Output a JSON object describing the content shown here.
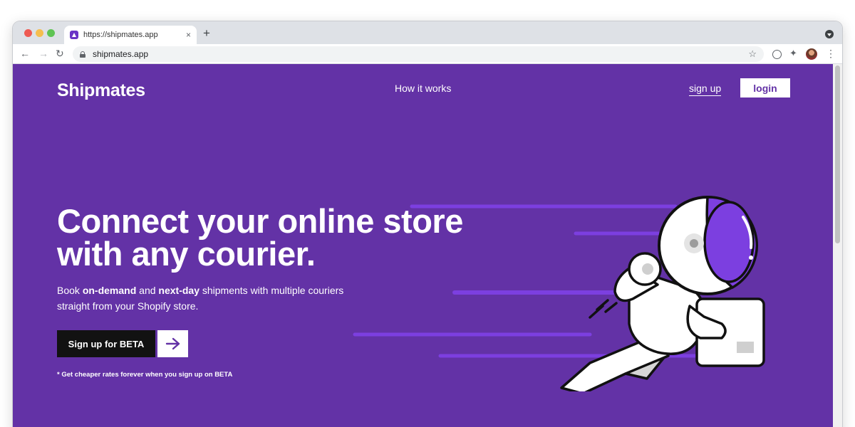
{
  "browser": {
    "tab_title": "https://shipmates.app",
    "tab_close": "×",
    "new_tab": "+",
    "address": "shipmates.app",
    "back": "←",
    "forward": "→",
    "reload": "↻",
    "star": "☆",
    "extensions": "✦",
    "menu": "⋮"
  },
  "site": {
    "logo": "Shipmates",
    "nav": {
      "how_it_works": "How it works",
      "sign_up": "sign up",
      "login": "login"
    },
    "hero": {
      "headline_line1": "Connect your online store",
      "headline_line2": "with any courier.",
      "sub_prefix": "Book ",
      "sub_bold1": "on-demand",
      "sub_mid": " and ",
      "sub_bold2": "next-day",
      "sub_suffix": " shipments with multiple couriers straight from your Shopify store.",
      "cta_label": "Sign up for BETA",
      "beta_note": "* Get cheaper rates forever when you sign up on BETA"
    }
  },
  "colors": {
    "brand_purple": "#6332a6",
    "accent_purple": "#7c3fe0",
    "cta_dark": "#121212"
  },
  "icons": {
    "favicon": "shipmates-icon",
    "lock": "lock-icon",
    "cta_arrow": "arrow-right-icon",
    "illustration": "astronaut-carrying-box"
  }
}
